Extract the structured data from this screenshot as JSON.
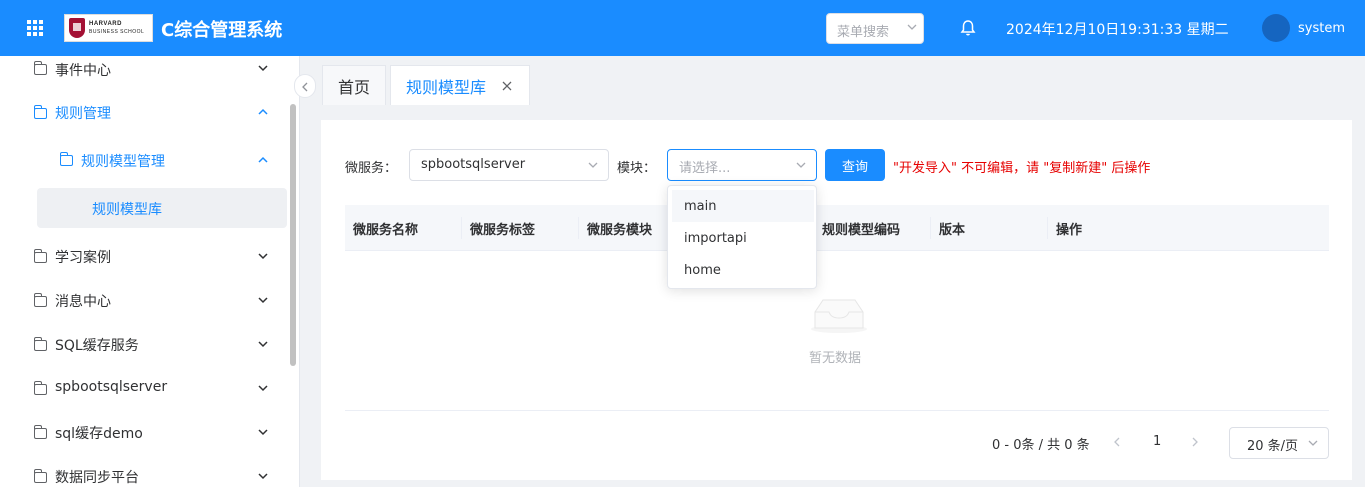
{
  "header": {
    "logo_line1": "HARVARD",
    "logo_line2": "BUSINESS SCHOOL",
    "title": "C综合管理系统",
    "menu_search_placeholder": "菜单搜索",
    "datetime": "2024年12月10日19:31:33 星期二",
    "username": "system",
    "header_color": "#1a8cff"
  },
  "sidebar": {
    "items": [
      {
        "label": "事件中心",
        "icon": "folder-icon",
        "expanded": false
      },
      {
        "label": "规则管理",
        "icon": "folder-icon",
        "expanded": true
      },
      {
        "label": "规则模型管理",
        "icon": "folder-icon",
        "expanded": true
      },
      {
        "label": "规则模型库",
        "selected": true
      },
      {
        "label": "学习案例",
        "icon": "folder-icon",
        "expanded": false
      },
      {
        "label": "消息中心",
        "icon": "folder-icon",
        "expanded": false
      },
      {
        "label": "SQL缓存服务",
        "icon": "folder-icon",
        "expanded": false
      },
      {
        "label": "spbootsqlserver",
        "icon": "folder-icon",
        "expanded": false
      },
      {
        "label": "sql缓存demo",
        "icon": "folder-icon",
        "expanded": false
      },
      {
        "label": "数据同步平台",
        "icon": "folder-icon",
        "expanded": false
      }
    ]
  },
  "tabs": [
    {
      "label": "首页",
      "active": false
    },
    {
      "label": "规则模型库",
      "active": true,
      "closable": true
    }
  ],
  "filters": {
    "microservice_label": "微服务：",
    "microservice_value": "spbootsqlserver",
    "module_label": "模块：",
    "module_placeholder": "请选择...",
    "query_button": "查询",
    "tip": "\"开发导入\" 不可编辑，请 \"复制新建\" 后操作"
  },
  "module_options": [
    "main",
    "importapi",
    "home"
  ],
  "table": {
    "columns": [
      "微服务名称",
      "微服务标签",
      "微服务模块",
      "规则模型编码",
      "版本",
      "操作"
    ],
    "rows": [],
    "empty_text": "暂无数据"
  },
  "pagination": {
    "total_text": "0 - 0条 / 共 0 条",
    "current_page": "1",
    "page_size": "20 条/页"
  }
}
